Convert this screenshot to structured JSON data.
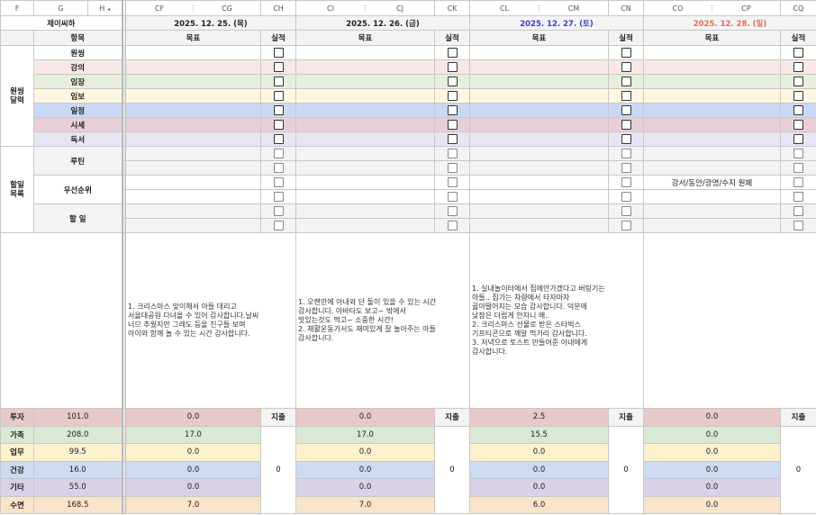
{
  "column_headers": {
    "left": [
      "F",
      "G",
      "H"
    ],
    "days": [
      [
        "CF",
        "CG",
        "CH"
      ],
      [
        "CI",
        "CJ",
        "CK"
      ],
      [
        "CL",
        "CM",
        "CN"
      ],
      [
        "CO",
        "CP",
        "CQ"
      ]
    ]
  },
  "owner": "제이씨하",
  "item_header": "항목",
  "goal_header": "목표",
  "result_header": "실적",
  "expense_label": "지출",
  "days": [
    {
      "date": "2025. 12. 25. (목)",
      "color": "#222222",
      "gratitude": "1. 크리스마스 맞이해서 아들 데리고\n서울대공원 다녀올 수 있어 감사합니다.날씨\n너므 추웠지만 그래도 등을 친구들 보며\n아이와 함께 놀 수 있는 시간 감사합니다.",
      "todo_texts": [
        "",
        "",
        "",
        "",
        "",
        ""
      ],
      "stats": [
        "0.0",
        "17.0",
        "0.0",
        "0.0",
        "0.0",
        "7.0"
      ],
      "expense": "0"
    },
    {
      "date": "2025. 12. 26. (금)",
      "color": "#222222",
      "gratitude": "1. 오랜만에 아내와 단 둘이 있을 수 있는 시간\n감사합니다. 아바타도 보고~ 밖에서\n맛있는것도 먹고~ 소중한 시간!\n2. 재활운동가서도 재미있게 잘 놀아주는 아들\n감사합니다.",
      "todo_texts": [
        "",
        "",
        "",
        "",
        "",
        ""
      ],
      "stats": [
        "0.0",
        "17.0",
        "0.0",
        "0.0",
        "0.0",
        "7.0"
      ],
      "expense": "0"
    },
    {
      "date": "2025. 12. 27. (토)",
      "color": "#3b3bd6",
      "gratitude": "1. 실내놀이터에서 집에안가겠다고 버팅기는\n아들.. 집가는 차량에서 타자마자\n곯아떨어지는 모습 감사합니다. 덕분에\n낮잠은 더럽게 안자니 왜..\n2. 크리스마스 선물로 받은 스타벅스\n기프티콘으로 깨알 먹거리 감사합니다.\n3. 저녁으로 토스트 만들어준 아내에게\n감사합니다.",
      "todo_texts": [
        "",
        "",
        "",
        "",
        "",
        ""
      ],
      "stats": [
        "2.5",
        "15.5",
        "0.0",
        "0.0",
        "0.0",
        "6.0"
      ],
      "expense": "0"
    },
    {
      "date": "2025. 12. 28. (일)",
      "color": "#d9705a",
      "gratitude": "",
      "todo_texts": [
        "",
        "",
        "강서/동안/광명/수지 원페",
        "",
        "",
        ""
      ],
      "stats": [
        "0.0",
        "0.0",
        "0.0",
        "0.0",
        "0.0",
        "0.0"
      ],
      "expense": "0"
    }
  ],
  "oneThing": {
    "group_label": "원씽\n달력",
    "items": [
      {
        "label": "원씽",
        "color": "#ffffff"
      },
      {
        "label": "강의",
        "color": "#f7e7e7"
      },
      {
        "label": "임장",
        "color": "#e5efdd"
      },
      {
        "label": "임보",
        "color": "#fff6e2"
      },
      {
        "label": "일정",
        "color": "#cad9f3"
      },
      {
        "label": "시세",
        "color": "#e6d0d6"
      },
      {
        "label": "독서",
        "color": "#e7e4f3"
      }
    ]
  },
  "todo": {
    "group_label": "할일\n목록",
    "items": [
      {
        "label": "루틴",
        "color": "#f3f3f3"
      },
      {
        "label": "우선순위",
        "color": "#ffffff"
      },
      {
        "label": "할 일",
        "color": "#f3f3f3"
      }
    ]
  },
  "stats": [
    {
      "label": "투자",
      "total": "101.0",
      "color": "#e7c9c9"
    },
    {
      "label": "가족",
      "total": "208.0",
      "color": "#dbe8d4"
    },
    {
      "label": "업무",
      "total": "99.5",
      "color": "#fdf1cc"
    },
    {
      "label": "건강",
      "total": "16.0",
      "color": "#ccdaf2"
    },
    {
      "label": "기타",
      "total": "55.0",
      "color": "#d9d2e6"
    },
    {
      "label": "수면",
      "total": "168.5",
      "color": "#f8e3cb"
    }
  ]
}
